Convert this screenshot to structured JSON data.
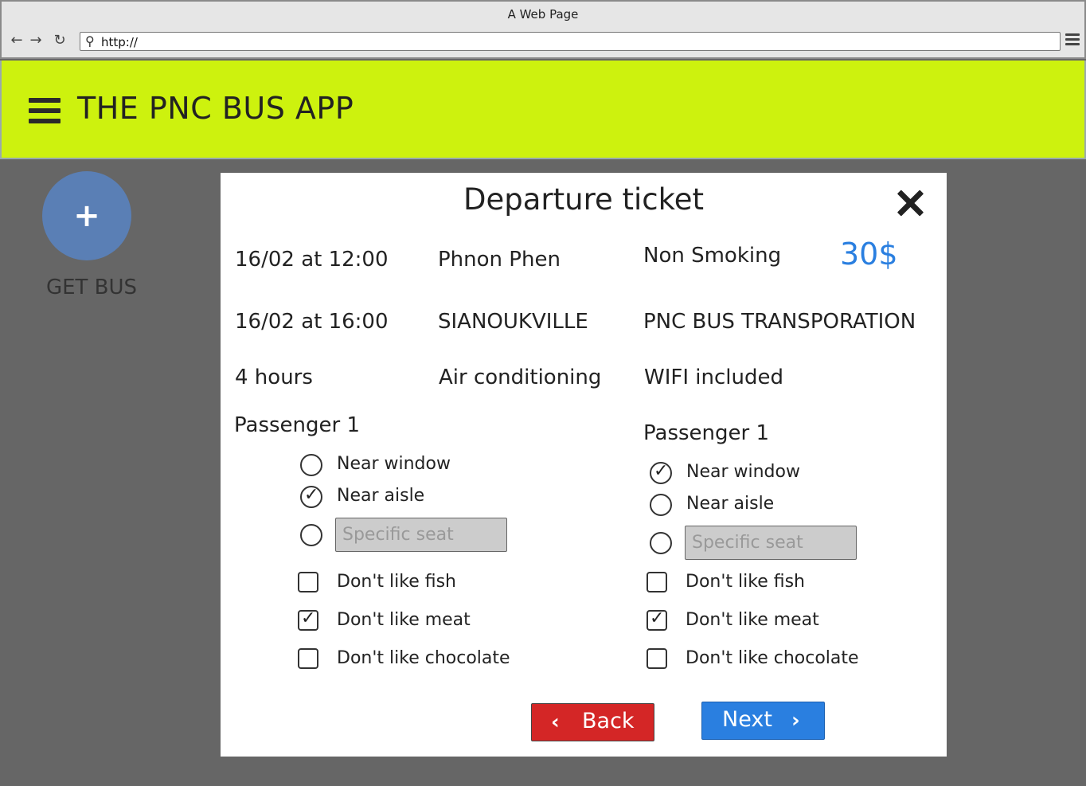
{
  "browser": {
    "title": "A Web Page",
    "url": "http://"
  },
  "header": {
    "title": "THE PNC BUS APP"
  },
  "sidebar": {
    "fab_icon": "+",
    "fab_label": "GET BUS"
  },
  "modal": {
    "title": "Departure ticket",
    "details": {
      "departure_time": "16/02 at 12:00",
      "from": "Phnon Phen",
      "smoking": "Non Smoking",
      "price": "30$",
      "arrival_time": "16/02 at 16:00",
      "to": "SIANOUKVILLE",
      "company": "PNC BUS TRANSPORATION",
      "duration": "4 hours",
      "ac": "Air conditioning",
      "wifi": "WIFI included"
    },
    "passengers": [
      {
        "heading": "Passenger 1",
        "seat_options": [
          {
            "label": "Near window",
            "checked": false
          },
          {
            "label": "Near aisle",
            "checked": true
          }
        ],
        "specific_seat_placeholder": "Specific seat",
        "preferences": [
          {
            "label": "Don't like fish",
            "checked": false
          },
          {
            "label": "Don't like meat",
            "checked": true
          },
          {
            "label": "Don't like chocolate",
            "checked": false
          }
        ]
      },
      {
        "heading": "Passenger 1",
        "seat_options": [
          {
            "label": "Near window",
            "checked": true
          },
          {
            "label": "Near aisle",
            "checked": false
          }
        ],
        "specific_seat_placeholder": "Specific seat",
        "preferences": [
          {
            "label": "Don't like fish",
            "checked": false
          },
          {
            "label": "Don't like meat",
            "checked": true
          },
          {
            "label": "Don't like chocolate",
            "checked": false
          }
        ]
      }
    ],
    "back_label": "Back",
    "next_label": "Next"
  },
  "colors": {
    "header_bg": "#cdf20e",
    "fab_bg": "#5a7fb5",
    "price": "#2a7fe0",
    "back_button": "#d42626",
    "next_button": "#2a7fe0",
    "backdrop": "#666666"
  },
  "icons": {
    "back": "arrow-left-icon",
    "forward": "arrow-right-icon",
    "reload": "reload-icon",
    "search": "search-icon",
    "browser_menu": "menu-icon",
    "app_menu": "hamburger-icon",
    "add": "plus-icon",
    "close": "close-icon"
  }
}
